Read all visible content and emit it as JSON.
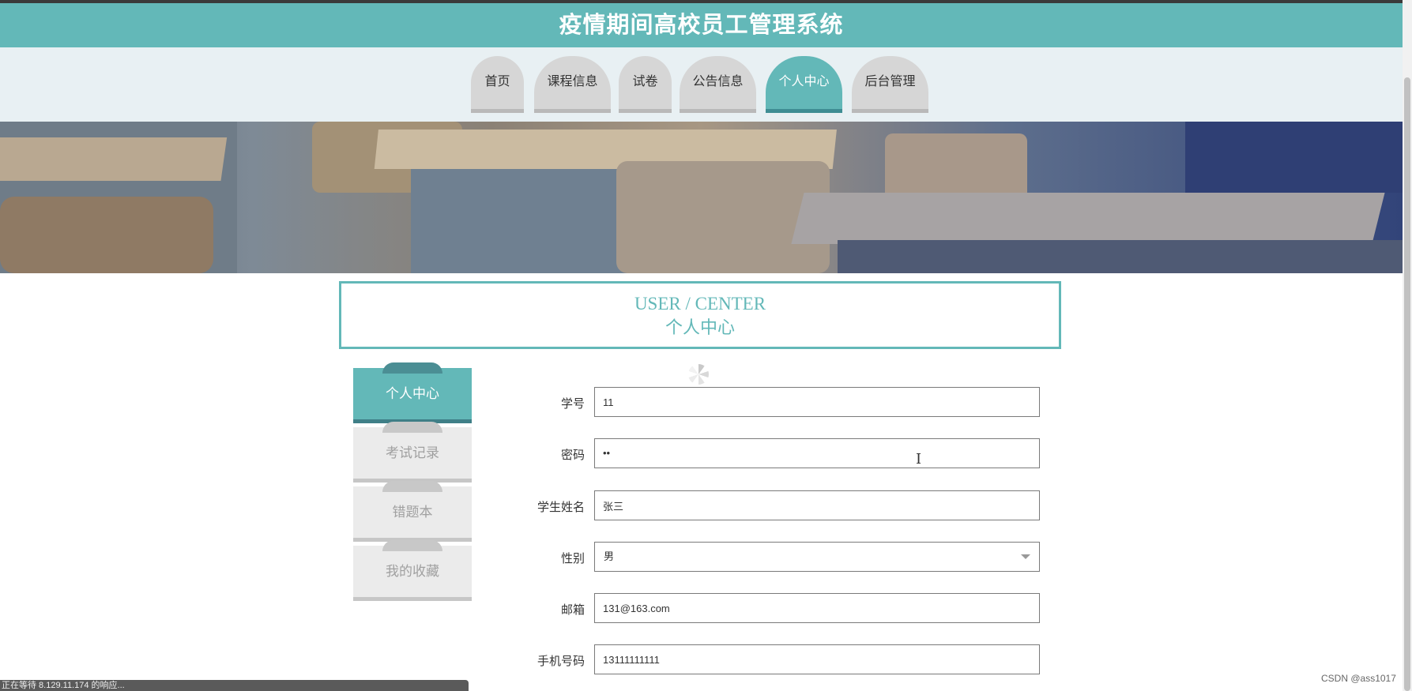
{
  "header": {
    "title": "疫情期间高校员工管理系统"
  },
  "nav": {
    "items": [
      {
        "label": "首页"
      },
      {
        "label": "课程信息"
      },
      {
        "label": "试卷"
      },
      {
        "label": "公告信息"
      },
      {
        "label": "个人中心"
      },
      {
        "label": "后台管理"
      }
    ],
    "active": "个人中心"
  },
  "section_title": {
    "en": "USER / CENTER",
    "cn": "个人中心"
  },
  "sidebar": {
    "items": [
      {
        "label": "个人中心"
      },
      {
        "label": "考试记录"
      },
      {
        "label": "错题本"
      },
      {
        "label": "我的收藏"
      }
    ],
    "active": "个人中心"
  },
  "form": {
    "student_id": {
      "label": "学号",
      "value": "11"
    },
    "password": {
      "label": "密码",
      "value": "••"
    },
    "student_name": {
      "label": "学生姓名",
      "value": "张三"
    },
    "gender": {
      "label": "性别",
      "value": "男"
    },
    "email": {
      "label": "邮箱",
      "value": "131@163.com"
    },
    "phone": {
      "label": "手机号码",
      "value": "13111111111"
    }
  },
  "status_bar": {
    "text": "正在等待 8.129.11.174 的响应..."
  },
  "watermark": {
    "text": "CSDN @ass1017"
  },
  "colors": {
    "accent": "#63b8b8",
    "nav_bg": "#e8f0f3",
    "tab_inactive": "#d6d6d6"
  }
}
